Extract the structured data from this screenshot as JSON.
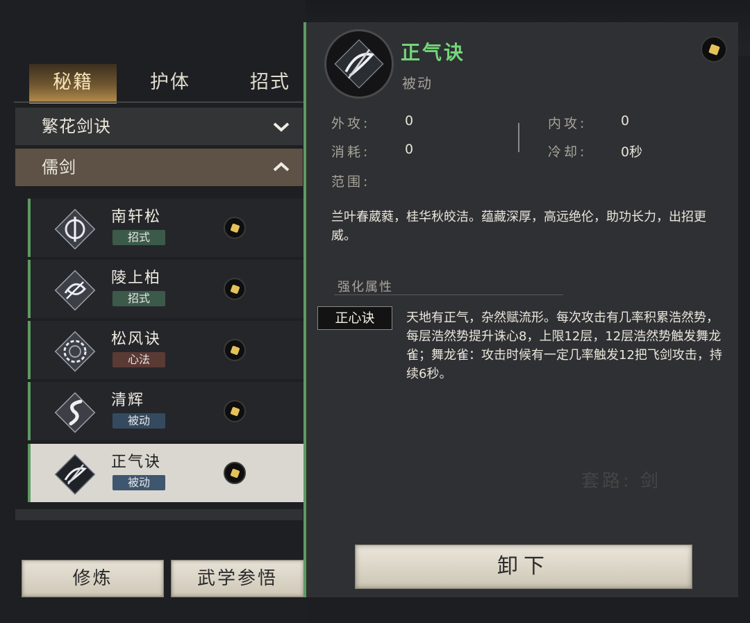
{
  "tabs": [
    {
      "label": "秘籍",
      "active": true
    },
    {
      "label": "护体",
      "active": false
    },
    {
      "label": "招式",
      "active": false
    }
  ],
  "categories": [
    {
      "label": "繁花剑诀",
      "state": "collapsed",
      "icon": "chevron-down-icon"
    },
    {
      "label": "儒剑",
      "state": "expanded",
      "icon": "chevron-up-icon"
    }
  ],
  "skills": [
    {
      "name": "南轩松",
      "badge": "招式",
      "icon": "sword-circle-icon"
    },
    {
      "name": "陵上柏",
      "badge": "招式",
      "icon": "sword-swirl-icon"
    },
    {
      "name": "松风诀",
      "badge": "心法",
      "icon": "ring-icon"
    },
    {
      "name": "清辉",
      "badge": "被动",
      "icon": "serpent-icon"
    },
    {
      "name": "正气诀",
      "badge": "被动",
      "icon": "sword-wave-icon",
      "selected": true
    }
  ],
  "buttons": {
    "cultivate": "修炼",
    "insight": "武学参悟"
  },
  "detail": {
    "title": "正气诀",
    "type": "被动",
    "stats": {
      "outer_attack_label": "外攻:",
      "outer_attack_value": "0",
      "inner_attack_label": "内攻:",
      "inner_attack_value": "0",
      "cost_label": "消耗:",
      "cost_value": "0",
      "cooldown_label": "冷却:",
      "cooldown_value": "0秒",
      "range_label": "范围:"
    },
    "description": "兰叶春葳蕤，桂华秋皎洁。蕴藏深厚，高远绝伦，助功长力，出招更威。",
    "enhance_title": "强化属性",
    "enhance_tag": "正心诀",
    "enhance_description": "天地有正气，杂然赋流形。每次攻击有几率积累浩然势，每层浩然势提升诛心8，上限12层，12层浩然势触发舞龙雀；舞龙雀：攻击时候有一定几率触发12把飞剑攻击，持续6秒。",
    "faded_label": "套路: 剑",
    "unequip": "卸下"
  },
  "colors": {
    "title_green": "#72d67a",
    "accent_gold": "#d8b26a",
    "row_green_bar": "#5e9a62"
  }
}
